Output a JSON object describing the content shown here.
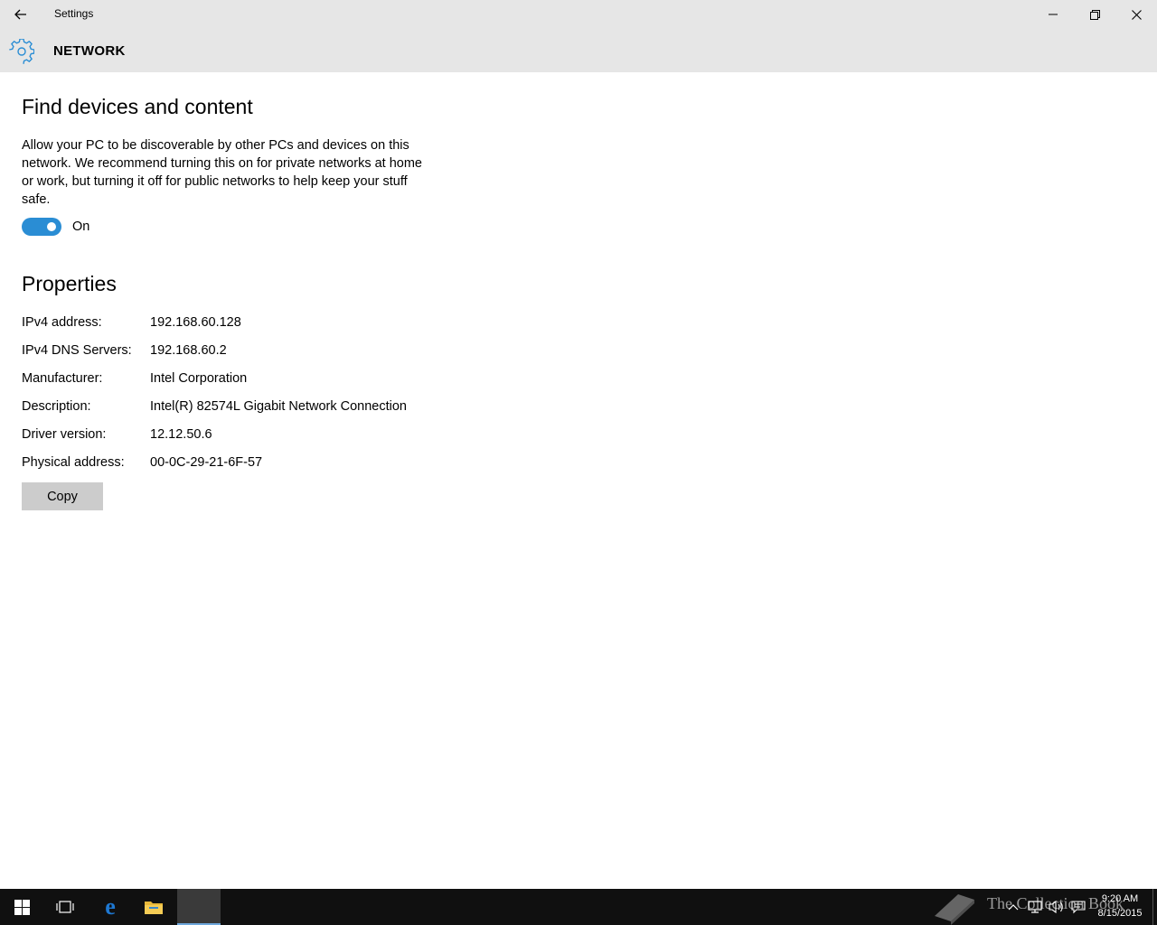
{
  "window": {
    "title": "Settings",
    "back_icon": "back-arrow-icon",
    "minimize_icon": "minimize-icon",
    "restore_icon": "restore-icon",
    "close_icon": "close-icon"
  },
  "header": {
    "icon": "gear-icon",
    "title": "NETWORK",
    "accent": "#2a8dd4"
  },
  "find_devices": {
    "heading": "Find devices and content",
    "description": "Allow your PC to be discoverable by other PCs and devices on this network. We recommend turning this on for private networks at home or work, but turning it off for public networks to help keep your stuff safe.",
    "toggle_state": "On",
    "toggle_on": true
  },
  "properties": {
    "heading": "Properties",
    "rows": [
      {
        "label": "IPv4 address:",
        "value": "192.168.60.128"
      },
      {
        "label": "IPv4 DNS Servers:",
        "value": "192.168.60.2"
      },
      {
        "label": "Manufacturer:",
        "value": "Intel Corporation"
      },
      {
        "label": "Description:",
        "value": "Intel(R) 82574L Gigabit Network Connection"
      },
      {
        "label": "Driver version:",
        "value": "12.12.50.6"
      },
      {
        "label": "Physical address:",
        "value": "00-0C-29-21-6F-57"
      }
    ],
    "copy_label": "Copy"
  },
  "taskbar": {
    "watermark": "The Collection Book",
    "clock_time": "9:20 AM",
    "clock_date": "8/15/2015",
    "items": [
      "start-icon",
      "task-view-icon",
      "edge-icon",
      "file-explorer-icon",
      "settings-app"
    ],
    "tray": [
      "chevron-up-icon",
      "network-icon",
      "volume-icon",
      "action-center-icon"
    ]
  }
}
